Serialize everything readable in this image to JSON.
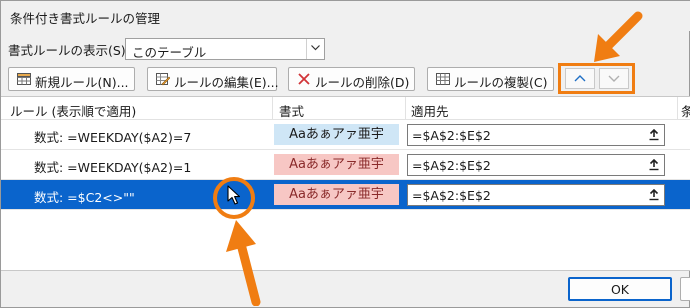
{
  "window": {
    "title": "条件付き書式ルールの管理"
  },
  "scope": {
    "label": "書式ルールの表示(S):",
    "value": "このテーブル"
  },
  "toolbar": {
    "new_label": "新規ルール(N)...",
    "edit_label": "ルールの編集(E)...",
    "delete_label": "ルールの削除(D)",
    "duplicate_label": "ルールの複製(C)"
  },
  "grid": {
    "headers": {
      "rule": "ルール (表示順で適用)",
      "format": "書式",
      "applies_to": "適用先",
      "extra": "条"
    },
    "rows": [
      {
        "rule": "数式: =WEEKDAY($A2)=7",
        "preview": "Aaあぁアァ亜宇",
        "applies_to": "=$A$2:$E$2"
      },
      {
        "rule": "数式: =WEEKDAY($A2)=1",
        "preview": "Aaあぁアァ亜宇",
        "applies_to": "=$A$2:$E$2"
      },
      {
        "rule": "数式: =$C2<>\"\"",
        "preview": "Aaあぁアァ亜宇",
        "applies_to": "=$A$2:$E$2"
      }
    ]
  },
  "footer": {
    "ok_label": "OK"
  },
  "colors": {
    "accent": "#0a64cc",
    "highlight": "#f07d12",
    "preview_blue": "#cfe6f6",
    "preview_pink": "#f7c7c4"
  },
  "icons": [
    "table-new-icon",
    "edit-rule-icon",
    "delete-x-icon",
    "table-duplicate-icon",
    "chevron-up-icon",
    "chevron-down-icon",
    "collapse-range-icon",
    "mouse-cursor-icon"
  ]
}
